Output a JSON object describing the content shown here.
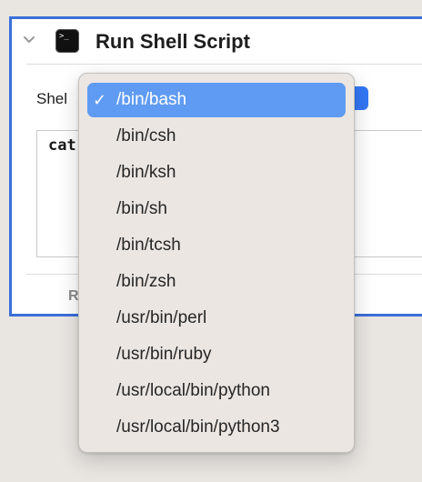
{
  "action": {
    "title": "Run Shell Script",
    "shell_label": "Shel",
    "script_text": "cat",
    "footer_tab_label": "R",
    "accent_color": "#3a6fd8"
  },
  "shell_menu": {
    "selected_color": "#5f9bf2",
    "check_mark": "✓",
    "items": [
      {
        "label": "/bin/bash",
        "selected": true
      },
      {
        "label": "/bin/csh",
        "selected": false
      },
      {
        "label": "/bin/ksh",
        "selected": false
      },
      {
        "label": "/bin/sh",
        "selected": false
      },
      {
        "label": "/bin/tcsh",
        "selected": false
      },
      {
        "label": "/bin/zsh",
        "selected": false
      },
      {
        "label": "/usr/bin/perl",
        "selected": false
      },
      {
        "label": "/usr/bin/ruby",
        "selected": false
      },
      {
        "label": "/usr/local/bin/python",
        "selected": false
      },
      {
        "label": "/usr/local/bin/python3",
        "selected": false
      }
    ]
  }
}
